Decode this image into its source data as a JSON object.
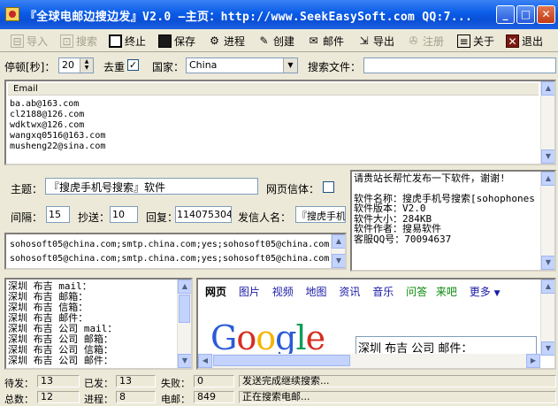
{
  "window": {
    "title": "『全球电邮边搜边发』V2.0  —主页：http://www.SeekEasySoft.com QQ:7...",
    "min_label": "_",
    "max_label": "□",
    "close_label": "✕"
  },
  "toolbar": {
    "import": "导入",
    "search": "搜索",
    "stop": "终止",
    "save": "保存",
    "progress": "进程",
    "create": "创建",
    "mail": "邮件",
    "export": "导出",
    "register": "注册",
    "about": "关于",
    "exit": "退出"
  },
  "options": {
    "pause_label": "停顿[秒]：",
    "pause_value": "20",
    "dedupe_label": "去重",
    "dedupe_checked": "✓",
    "country_label": "国家：",
    "country_value": "China",
    "search_file_label": "搜索文件："
  },
  "email_list": {
    "header": "Email",
    "items": [
      "ba.ab@163.com",
      "cl2188@126.com",
      "wdktwx@126.com",
      "wangxq0516@163.com",
      "musheng22@sina.com"
    ]
  },
  "compose": {
    "subject_label": "主题：",
    "subject_value": "『搜虎手机号搜索』软件",
    "html_label": "网页信体：",
    "interval_label": "间隔：",
    "interval_value": "15",
    "cc_label": "抄送：",
    "cc_value": "10",
    "reply_label": "回复：",
    "reply_value": "1140753040",
    "sender_label": "发信人名：",
    "sender_value": "『搜虎手机",
    "smtp_lines": [
      "sohosoft05@china.com;smtp.china.com;yes;sohosoft05@china.com;",
      "sohosoft05@china.com;smtp.china.com;yes;sohosoft05@china.com;"
    ]
  },
  "info_box": {
    "lines": [
      "请贵站长帮忙发布一下软件，谢谢!",
      "",
      "软件名称：搜虎手机号搜索[sohophones",
      "软件版本：V2.0",
      "软件大小：284KB",
      "软件作者：搜易软件",
      "客服QQ号：70094637"
    ]
  },
  "keywords": {
    "lines": [
      "深圳 布吉 mail：",
      "深圳 布吉 邮箱：",
      "深圳 布吉 信箱：",
      "深圳 布吉 邮件：",
      "深圳 布吉 公司 mail：",
      "深圳 布吉 公司 邮箱：",
      "深圳 布吉 公司 信箱：",
      "深圳 布吉 公司 邮件："
    ]
  },
  "browser": {
    "tabs": [
      "网页",
      "图片",
      "视频",
      "地图",
      "资讯",
      "音乐",
      "问答",
      "来吧",
      "更多"
    ],
    "logo": "Google",
    "search_value": "深圳 布吉 公司 邮件："
  },
  "status": {
    "pending_label": "待发：",
    "pending_value": "13",
    "sent_label": "已发：",
    "sent_value": "13",
    "failed_label": "失败：",
    "failed_value": "0",
    "message1": "发送完成继续搜索...",
    "total_label": "总数：",
    "total_value": "12",
    "threads_label": "进程：",
    "threads_value": "8",
    "email_count_label": "电邮：",
    "email_count_value": "849",
    "message2": "正在搜索电邮..."
  },
  "colors": {
    "titlebar": "#0A5CE8",
    "google_blue": "#2A5BD7",
    "google_red": "#D62D20",
    "google_yellow": "#F4B400",
    "google_green": "#0F9D58"
  }
}
